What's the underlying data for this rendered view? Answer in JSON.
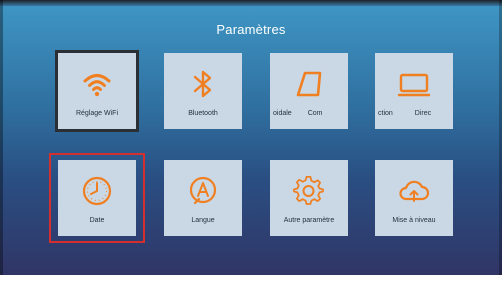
{
  "header": {
    "title": "Paramètres"
  },
  "tiles": [
    {
      "label": "Réglage WiFi",
      "icon": "wifi-icon"
    },
    {
      "label": "Bluetooth",
      "icon": "bluetooth-icon"
    },
    {
      "label_left": "oidale",
      "label_right": "Com",
      "icon": "keystone-icon"
    },
    {
      "label_left": "ction",
      "label_right": "Direc",
      "icon": "screen-icon"
    },
    {
      "label": "Date",
      "icon": "clock-icon"
    },
    {
      "label": "Langue",
      "icon": "language-icon"
    },
    {
      "label": "Autre paramètre",
      "icon": "gear-icon"
    },
    {
      "label": "Mise à niveau",
      "icon": "cloud-upgrade-icon"
    }
  ],
  "colors": {
    "accent": "#f07f22",
    "tile": "#c9d8e4",
    "focus": "#d32f2f"
  }
}
